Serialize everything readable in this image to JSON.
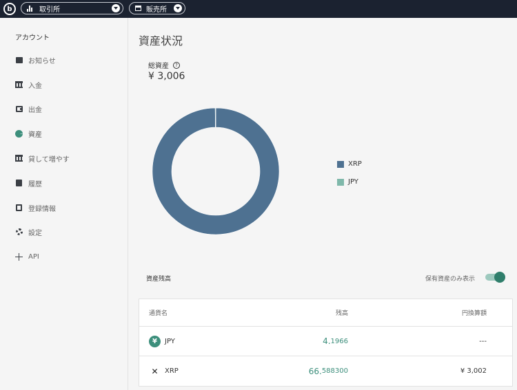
{
  "topbar": {
    "exchange_label": "取引所",
    "store_label": "販売所"
  },
  "sidebar": {
    "title": "アカウント",
    "items": [
      {
        "label": "お知らせ",
        "icon": "message-icon"
      },
      {
        "label": "入金",
        "icon": "bank-icon"
      },
      {
        "label": "出金",
        "icon": "wallet-icon"
      },
      {
        "label": "資産",
        "icon": "pie-chart-icon",
        "active": true
      },
      {
        "label": "貸して増やす",
        "icon": "bank-icon"
      },
      {
        "label": "履歴",
        "icon": "clipboard-icon"
      },
      {
        "label": "登録情報",
        "icon": "user-card-icon"
      },
      {
        "label": "設定",
        "icon": "gear-icon"
      },
      {
        "label": "API",
        "icon": "move-icon"
      }
    ]
  },
  "main": {
    "title": "資産状況",
    "total_label": "総資産",
    "total_value": "¥ 3,006",
    "chart_data": {
      "type": "pie",
      "categories": [
        "XRP",
        "JPY"
      ],
      "values": [
        3002,
        4.1966
      ],
      "colors": [
        "#4e7191",
        "#7fb8aa"
      ],
      "legend": "right"
    },
    "holdings": {
      "title": "資産残高",
      "toggle_label": "保有資産のみ表示",
      "toggle_on": true,
      "columns": [
        "通貨名",
        "残高",
        "円換算額"
      ],
      "rows": [
        {
          "currency": "JPY",
          "icon": "yen-icon",
          "balance_main": "4.",
          "balance_rest": "1966",
          "jpy": "---"
        },
        {
          "currency": "XRP",
          "icon": "xrp-icon",
          "balance_main": "66.",
          "balance_rest": "588300",
          "jpy": "¥ 3,002"
        }
      ]
    }
  }
}
